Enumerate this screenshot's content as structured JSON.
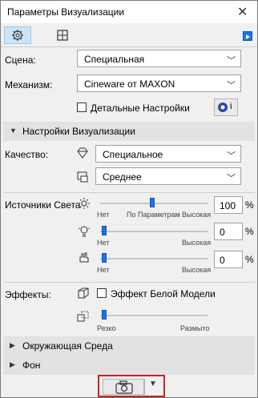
{
  "window": {
    "title": "Параметры Визуализации"
  },
  "scene": {
    "label": "Сцена:",
    "value": "Специальная"
  },
  "engine": {
    "label": "Механизм:",
    "value": "Cineware от MAXON"
  },
  "detail_settings": {
    "label": "Детальные Настройки",
    "checked": false,
    "info_badge": "i"
  },
  "render_settings": {
    "header": "Настройки Визуализации"
  },
  "quality": {
    "label": "Качество:",
    "value1": "Специальное",
    "value2": "Среднее"
  },
  "light_sources": {
    "label": "Источники Света",
    "sun": {
      "value": "100",
      "unit": "%",
      "min_label": "Нет",
      "mid_label": "По Параметрам",
      "max_label": "Высокая",
      "level": 0.55
    },
    "lamp": {
      "value": "0",
      "unit": "%",
      "min_label": "Нет",
      "max_label": "Высокая",
      "level": 0.03
    },
    "environment": {
      "value": "0",
      "unit": "%",
      "min_label": "Нет",
      "max_label": "Высокая",
      "level": 0.03
    }
  },
  "effects": {
    "label": "Эффекты:",
    "white_model": {
      "label": "Эффект Белой Модели",
      "checked": false
    },
    "blur": {
      "min_label": "Резко",
      "max_label": "Размыто",
      "level": 0.03
    }
  },
  "sections": {
    "environment": "Окружающая Среда",
    "background": "Фон"
  },
  "icons": {
    "close": "close-icon",
    "gear": "gear-icon",
    "grid": "grid-icon",
    "expand": "blue-triangle-icon",
    "chevron": "chevron-down-icon",
    "diamond": "diamond-icon",
    "monitor": "monitor-icon",
    "sun": "sun-icon",
    "lamp": "lamp-icon",
    "hand": "hand-icon",
    "cube": "cube-icon",
    "blur": "blur-icon",
    "camera": "camera-icon"
  },
  "colors": {
    "accent": "#1a73e8",
    "highlight_border": "#d11f1f",
    "section_bg": "#e2e2e2"
  }
}
